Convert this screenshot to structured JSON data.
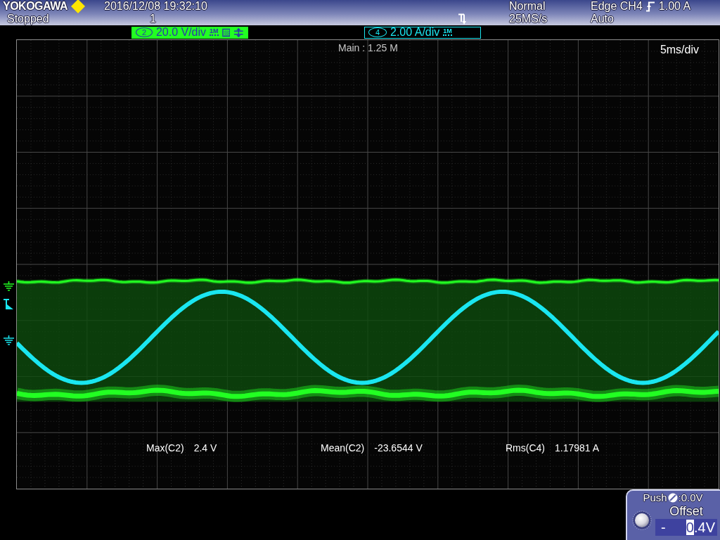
{
  "header": {
    "brand": "YOKOGAWA",
    "datetime": "2016/12/08 19:32:10",
    "run_state": "Stopped",
    "acquisition_count": "1",
    "trigger_mode": "Normal",
    "sample_rate": "25MS/s",
    "trigger": {
      "label": "Edge CH4",
      "rising_edge": true,
      "threshold": "1.00 A"
    },
    "trigger_sweep": "Auto"
  },
  "channels": [
    {
      "number": "2",
      "scale": "20.0 V/div",
      "impedance": "1M",
      "selected": true,
      "color": "#22ff22",
      "indicators": [
        {
          "kind": "hatched-square"
        },
        {
          "kind": "double-arrow"
        }
      ]
    },
    {
      "number": "4",
      "scale": "2.00 A/div",
      "impedance": "1M",
      "selected": false,
      "color": "#1ae6f0"
    }
  ],
  "display": {
    "record_length": "Main : 1.25 M",
    "timebase": "5ms/div"
  },
  "measurements": [
    {
      "name": "Max(C2)",
      "value": "2.4 V"
    },
    {
      "name": "Mean(C2)",
      "value": "-23.6544 V"
    },
    {
      "name": "Rms(C4)",
      "value": "1.17981 A"
    }
  ],
  "offset_panel": {
    "push_label": "Push",
    "push_value": ":0.0V",
    "title": "Offset",
    "sign": "-",
    "value": "**0**.4V"
  }
}
